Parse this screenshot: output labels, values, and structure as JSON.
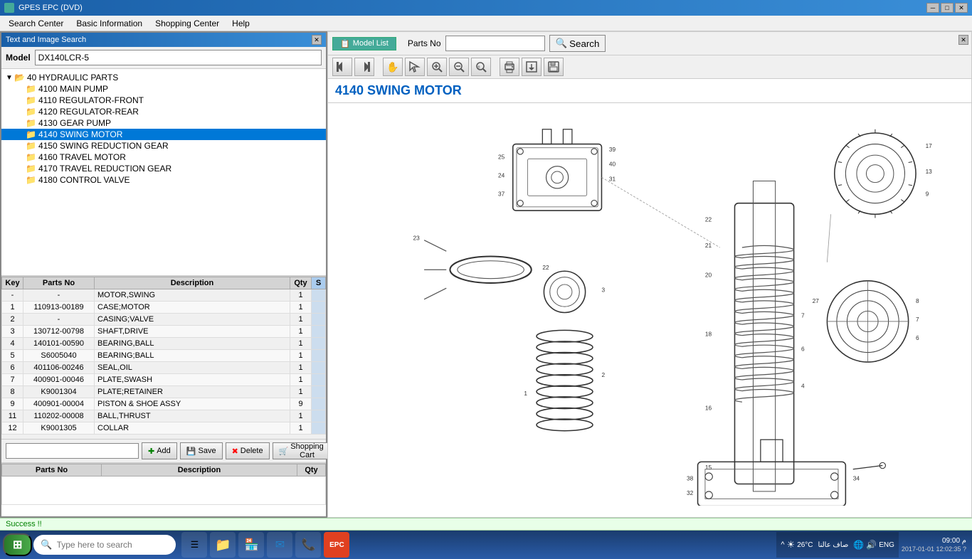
{
  "titleBar": {
    "title": "GPES EPC (DVD)",
    "icon": "app-icon"
  },
  "menuBar": {
    "items": [
      "Search Center",
      "Basic Information",
      "Shopping Center",
      "Help"
    ]
  },
  "leftPanel": {
    "title": "Text and Image Search",
    "model": {
      "label": "Model",
      "value": "DX140LCR-5"
    },
    "tree": {
      "root": {
        "label": "40 HYDRAULIC PARTS",
        "children": [
          {
            "label": "4100 MAIN PUMP"
          },
          {
            "label": "4110 REGULATOR-FRONT"
          },
          {
            "label": "4120 REGULATOR-REAR"
          },
          {
            "label": "4130 GEAR PUMP"
          },
          {
            "label": "4140 SWING MOTOR",
            "selected": true
          },
          {
            "label": "4150 SWING REDUCTION GEAR"
          },
          {
            "label": "4160 TRAVEL MOTOR"
          },
          {
            "label": "4170 TRAVEL REDUCTION GEAR"
          },
          {
            "label": "4180 CONTROL VALVE"
          }
        ]
      }
    },
    "partsTable": {
      "columns": [
        "Key",
        "Parts No",
        "Description",
        "Qty",
        "S"
      ],
      "rows": [
        {
          "key": "-",
          "partsNo": "-",
          "description": "MOTOR,SWING",
          "qty": "1",
          "s": ""
        },
        {
          "key": "1",
          "partsNo": "110913-00189",
          "description": "CASE;MOTOR",
          "qty": "1",
          "s": ""
        },
        {
          "key": "2",
          "partsNo": "-",
          "description": "CASING;VALVE",
          "qty": "1",
          "s": ""
        },
        {
          "key": "3",
          "partsNo": "130712-00798",
          "description": "SHAFT,DRIVE",
          "qty": "1",
          "s": ""
        },
        {
          "key": "4",
          "partsNo": "140101-00590",
          "description": "BEARING,BALL",
          "qty": "1",
          "s": ""
        },
        {
          "key": "5",
          "partsNo": "S6005040",
          "description": "BEARING;BALL",
          "qty": "1",
          "s": ""
        },
        {
          "key": "6",
          "partsNo": "401106-00246",
          "description": "SEAL,OIL",
          "qty": "1",
          "s": ""
        },
        {
          "key": "7",
          "partsNo": "400901-00046",
          "description": "PLATE,SWASH",
          "qty": "1",
          "s": ""
        },
        {
          "key": "8",
          "partsNo": "K9001304",
          "description": "PLATE;RETAINER",
          "qty": "1",
          "s": ""
        },
        {
          "key": "9",
          "partsNo": "400901-00004",
          "description": "PISTON & SHOE ASSY",
          "qty": "9",
          "s": ""
        },
        {
          "key": "11",
          "partsNo": "110202-00008",
          "description": "BALL,THRUST",
          "qty": "1",
          "s": ""
        },
        {
          "key": "12",
          "partsNo": "K9001305",
          "description": "COLLAR",
          "qty": "1",
          "s": ""
        }
      ]
    },
    "toolbar": {
      "addLabel": "Add",
      "saveLabel": "Save",
      "deleteLabel": "Delete",
      "shoppingCartLabel": "Shopping Cart"
    },
    "cartTable": {
      "columns": [
        "Parts No",
        "Description",
        "Qty"
      ],
      "rows": []
    }
  },
  "rightPanel": {
    "modelListLabel": "Model List",
    "partsNoLabel": "Parts No",
    "partsNoValue": "",
    "searchLabel": "Search",
    "diagramTitle": "4140 SWING MOTOR",
    "toolbarIcons": [
      {
        "name": "first-icon",
        "symbol": "⏮"
      },
      {
        "name": "prev-icon",
        "symbol": "⏩"
      },
      {
        "name": "pan-icon",
        "symbol": "✋"
      },
      {
        "name": "zoom-in-icon",
        "symbol": "🔍"
      },
      {
        "name": "zoom-in2-icon",
        "symbol": "🔎"
      },
      {
        "name": "zoom-out-icon",
        "symbol": "🔍"
      },
      {
        "name": "zoom-fit-icon",
        "symbol": "🔭"
      },
      {
        "name": "print-icon",
        "symbol": "🖨"
      },
      {
        "name": "export-icon",
        "symbol": "📤"
      },
      {
        "name": "export2-icon",
        "symbol": "💾"
      }
    ]
  },
  "statusBar": {
    "message": "Success !!"
  },
  "taskbar": {
    "startLabel": "⊞",
    "searchPlaceholder": "Type here to search",
    "icons": [
      "☰",
      "📁",
      "🏪",
      "✉",
      "📞",
      "📺"
    ],
    "tray": {
      "weather": "☀",
      "temp": "26°C",
      "arabic": "صاف عالنا",
      "network": "🌐",
      "volume": "🔊",
      "lang": "ENG"
    },
    "clock": {
      "time": "09:00 م",
      "date": "2017-01-01 12:02:35 ?"
    }
  }
}
